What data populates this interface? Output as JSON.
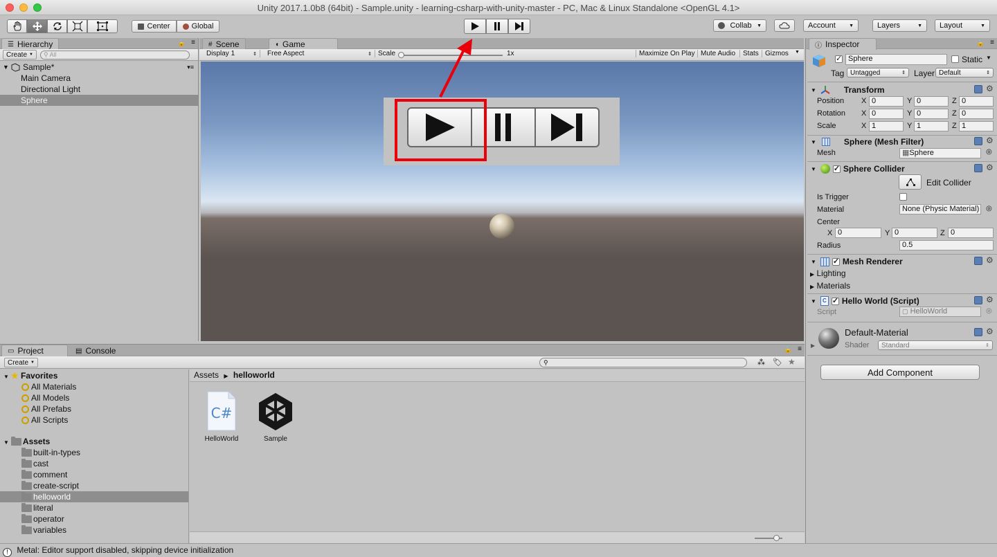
{
  "window": {
    "title": "Unity 2017.1.0b8 (64bit) - Sample.unity - learning-csharp-with-unity-master - PC, Mac & Linux Standalone <OpenGL 4.1>"
  },
  "toolbar": {
    "tools": [
      "hand-tool",
      "move-tool",
      "rotate-tool",
      "scale-tool",
      "rect-tool"
    ],
    "pivot": "Center",
    "space": "Global",
    "collab": "Collab",
    "account": "Account",
    "layers": "Layers",
    "layout": "Layout"
  },
  "hierarchy": {
    "tab": "Hierarchy",
    "create": "Create",
    "search_placeholder": "All",
    "scene": "Sample*",
    "items": [
      "Main Camera",
      "Directional Light",
      "Sphere"
    ],
    "selected": "Sphere"
  },
  "game": {
    "tabs": [
      "Scene",
      "Game"
    ],
    "display": "Display 1",
    "aspect": "Free Aspect",
    "scale_label": "Scale",
    "scale_value": "1x",
    "buttons": [
      "Maximize On Play",
      "Mute Audio",
      "Stats",
      "Gizmos"
    ]
  },
  "inspector": {
    "tab": "Inspector",
    "object_name": "Sphere",
    "static_label": "Static",
    "tag_label": "Tag",
    "tag": "Untagged",
    "layer_label": "Layer",
    "layer": "Default",
    "transform": {
      "title": "Transform",
      "rows": [
        {
          "label": "Position",
          "x": "0",
          "y": "0",
          "z": "0"
        },
        {
          "label": "Rotation",
          "x": "0",
          "y": "0",
          "z": "0"
        },
        {
          "label": "Scale",
          "x": "1",
          "y": "1",
          "z": "1"
        }
      ]
    },
    "mesh_filter": {
      "title": "Sphere (Mesh Filter)",
      "mesh_label": "Mesh",
      "mesh": "Sphere"
    },
    "sphere_collider": {
      "title": "Sphere Collider",
      "edit_label": "Edit Collider",
      "is_trigger_label": "Is Trigger",
      "material_label": "Material",
      "material": "None (Physic Material)",
      "center_label": "Center",
      "center": {
        "x": "0",
        "y": "0",
        "z": "0"
      },
      "radius_label": "Radius",
      "radius": "0.5"
    },
    "mesh_renderer": {
      "title": "Mesh Renderer",
      "lighting": "Lighting",
      "materials": "Materials"
    },
    "script": {
      "title": "Hello World (Script)",
      "script_label": "Script",
      "script": "HelloWorld"
    },
    "material": {
      "name": "Default-Material",
      "shader_label": "Shader",
      "shader": "Standard"
    },
    "add_component": "Add Component"
  },
  "project": {
    "tabs": [
      "Project",
      "Console"
    ],
    "create": "Create",
    "favorites": {
      "label": "Favorites",
      "items": [
        "All Materials",
        "All Models",
        "All Prefabs",
        "All Scripts"
      ]
    },
    "assets": {
      "label": "Assets",
      "folders": [
        "built-in-types",
        "cast",
        "comment",
        "create-script",
        "helloworld",
        "literal",
        "operator",
        "variables"
      ]
    },
    "selected_folder": "helloworld",
    "breadcrumb": [
      "Assets",
      "helloworld"
    ],
    "files": [
      {
        "name": "HelloWorld",
        "type": "csharp-script-icon"
      },
      {
        "name": "Sample",
        "type": "unity-scene-icon"
      }
    ]
  },
  "status": {
    "message": "Metal: Editor support disabled, skipping device initialization"
  },
  "colors": {
    "highlight": "#e8000a",
    "selection": "#8e8e8e",
    "sky_top": "#5a78a8",
    "ground": "#5c5450"
  }
}
